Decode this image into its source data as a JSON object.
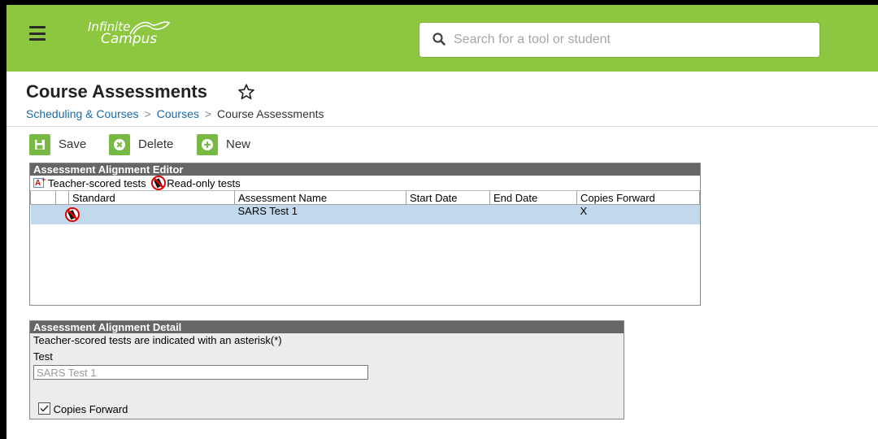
{
  "topbar": {
    "logo_line1": "Infinite",
    "logo_line2": "Campus",
    "search_placeholder": "Search for a tool or student",
    "color": "#8dc63f"
  },
  "page": {
    "title": "Course Assessments",
    "breadcrumb": [
      "Scheduling & Courses",
      "Courses",
      "Course Assessments"
    ]
  },
  "toolbar": {
    "save_label": "Save",
    "delete_label": "Delete",
    "new_label": "New"
  },
  "editor": {
    "header": "Assessment Alignment Editor",
    "legend_teacher": "Teacher-scored tests",
    "legend_readonly": "Read-only tests",
    "columns": [
      "",
      "Standard",
      "Assessment Name",
      "Start Date",
      "End Date",
      "Copies Forward"
    ],
    "rows": [
      {
        "icon": "read-only-icon",
        "standard": "",
        "name": "SARS Test 1",
        "start": "",
        "end": "",
        "copies_forward": "X"
      }
    ]
  },
  "detail": {
    "header": "Assessment Alignment Detail",
    "note": "Teacher-scored tests are indicated with an asterisk(*)",
    "test_label": "Test",
    "test_value": "SARS Test 1",
    "copies_forward_label": "Copies Forward",
    "copies_forward_checked": true
  },
  "icons": {
    "menu": "hamburger-menu-icon",
    "search": "search-icon",
    "favorite": "star-outline-icon",
    "save": "save-icon",
    "delete": "delete-icon",
    "new": "add-icon"
  }
}
